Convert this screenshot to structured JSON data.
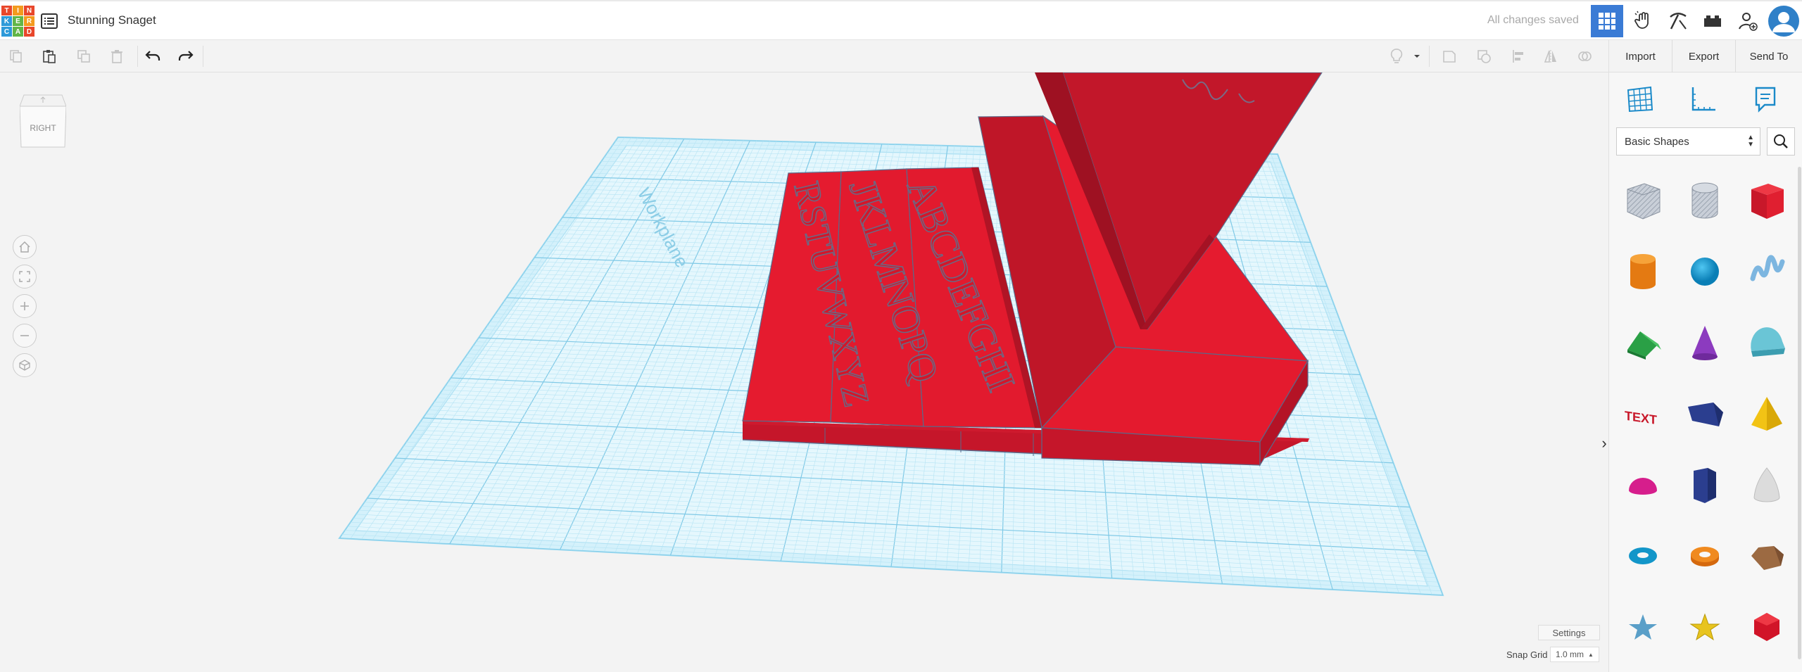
{
  "app": {
    "logo_letters": [
      "T",
      "I",
      "N",
      "K",
      "E",
      "R",
      "C",
      "A",
      "D"
    ],
    "logo_colors": [
      "#e8472b",
      "#f39a1e",
      "#e8472b",
      "#2e9ad9",
      "#61b547",
      "#f39a1e",
      "#2e9ad9",
      "#61b547",
      "#e8472b"
    ],
    "design_title": "Stunning Snaget",
    "save_status": "All changes saved",
    "accent": "#3a7bd5"
  },
  "top_icons": [
    "3d-view-icon",
    "blocks-icon",
    "bricks-icon",
    "lego-icon",
    "invite-user-icon"
  ],
  "toolbar": {
    "left_icons": [
      "copy-icon",
      "paste-icon",
      "duplicate-icon",
      "delete-icon",
      "undo-icon",
      "redo-icon"
    ],
    "right_icons": [
      "light-bulb-icon",
      "chevron-down-icon",
      "note-icon",
      "hole-icon",
      "align-icon",
      "mirror-icon",
      "group-icon"
    ]
  },
  "actions": {
    "import": "Import",
    "export": "Export",
    "send_to": "Send To"
  },
  "viewcube": {
    "face_label": "RIGHT"
  },
  "workplane": {
    "label": "Workplane",
    "grid_color": "#7fd0ee",
    "plane_color": "#cdeefa",
    "model_color": "#e51b2f",
    "model_text_row1": "ABCDEFGHI",
    "model_text_row2": "JKLMNOPQ",
    "model_text_row3": "RSTUVWXYZ"
  },
  "bottom": {
    "settings": "Settings",
    "snap_grid_label": "Snap Grid",
    "snap_grid_value": "1.0 mm"
  },
  "panel": {
    "tabs": [
      "grid-icon",
      "ruler-icon",
      "notes-icon"
    ],
    "library_select": "Basic Shapes",
    "shapes": [
      "box-hole",
      "cylinder-hole",
      "box",
      "cylinder",
      "sphere",
      "scribble",
      "roof",
      "cone",
      "round-roof",
      "text",
      "wedge",
      "pyramid",
      "half-sphere",
      "polygon",
      "paraboloid",
      "torus",
      "tube",
      "icosahedron",
      "star",
      "star-gold",
      "gem"
    ]
  }
}
